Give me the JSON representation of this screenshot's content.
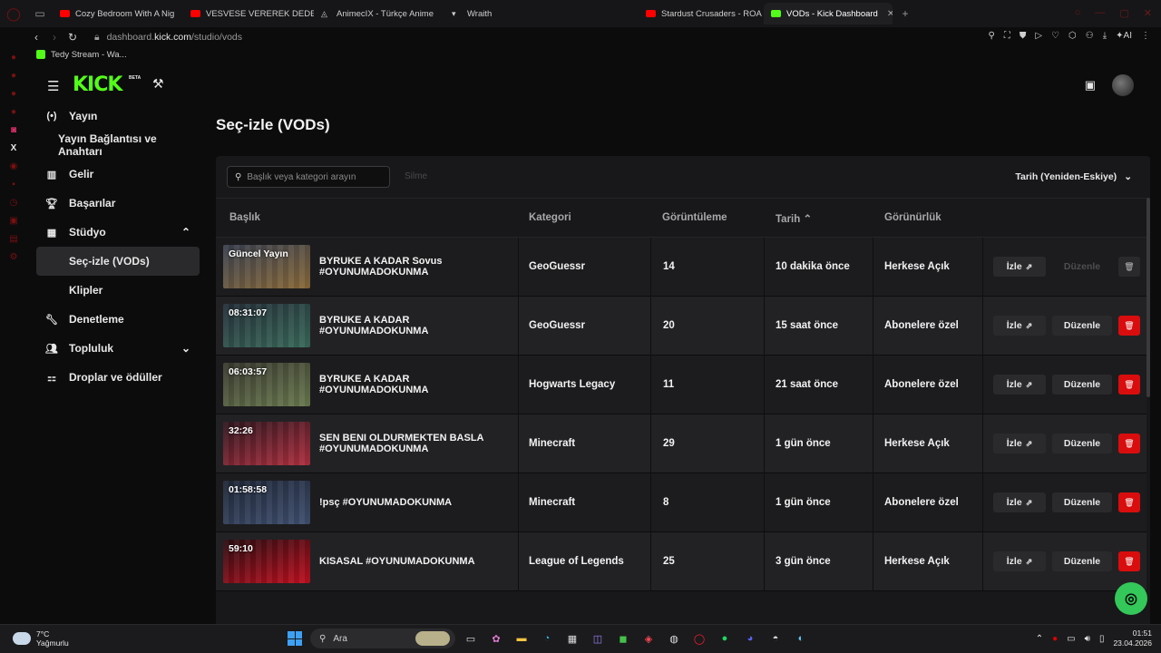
{
  "browser": {
    "tabs": [
      {
        "label": "Cozy Bedroom With A Nig",
        "favicon": "youtube-icon"
      },
      {
        "label": "VESVESE VEREREK DEDE",
        "favicon": "youtube-icon"
      },
      {
        "label": "AnimecIX - Türkçe Anime",
        "favicon": "animecix-icon"
      },
      {
        "label": "Wraith",
        "favicon": "wraith-icon"
      },
      {
        "label": "Stardust Crusaders - ROA",
        "favicon": "youtube-icon"
      },
      {
        "label": "VODs - Kick Dashboard",
        "favicon": "kick-icon",
        "active": true
      }
    ],
    "url_prefix": "dashboard.",
    "url_domain": "kick.com",
    "url_path": "/studio/vods",
    "ai_label": "AI",
    "bookmark": "Tedy Stream - Wa..."
  },
  "app": {
    "logo": "KICK",
    "beta": "BETA",
    "accent": "#53fc18"
  },
  "sidebar": {
    "items": [
      {
        "label": "Yayın",
        "icon": "broadcast-icon"
      },
      {
        "label": "Yayın Bağlantısı ve Anahtarı"
      },
      {
        "label": "Gelir",
        "icon": "revenue-icon"
      },
      {
        "label": "Başarılar",
        "icon": "trophy-icon"
      },
      {
        "label": "Stüdyo",
        "icon": "studio-icon"
      },
      {
        "label": "Seç-izle (VODs)"
      },
      {
        "label": "Klipler"
      },
      {
        "label": "Denetleme",
        "icon": "moderation-icon"
      },
      {
        "label": "Topluluk",
        "icon": "community-icon"
      },
      {
        "label": "Droplar ve ödüller",
        "icon": "drops-icon"
      }
    ]
  },
  "main": {
    "title": "Seç-izle (VODs)",
    "search_placeholder": "Başlık veya kategori arayın",
    "delete_label": "Silme",
    "sort_label": "Tarih (Yeniden-Eskiye)",
    "columns": [
      "Başlık",
      "Kategori",
      "Görüntüleme",
      "Tarih",
      "Görünürlük"
    ],
    "watch_label": "İzle",
    "edit_label": "Düzenle",
    "rows": [
      {
        "duration": "Güncel Yayın",
        "title": "BYRUKE A KADAR Sovus #OYUNUMADOKUNMA",
        "category": "GeoGuessr",
        "views": "14",
        "date": "10 dakika önce",
        "visibility": "Herkese Açık",
        "edit_disabled": true
      },
      {
        "duration": "08:31:07",
        "title": "BYRUKE A KADAR #OYUNUMADOKUNMA",
        "category": "GeoGuessr",
        "views": "20",
        "date": "15 saat önce",
        "visibility": "Abonelere özel"
      },
      {
        "duration": "06:03:57",
        "title": "BYRUKE A KADAR #OYUNUMADOKUNMA",
        "category": "Hogwarts Legacy",
        "views": "11",
        "date": "21 saat önce",
        "visibility": "Abonelere özel"
      },
      {
        "duration": "32:26",
        "title": "SEN BENI OLDURMEKTEN BASLA #OYUNUMADOKUNMA",
        "category": "Minecraft",
        "views": "29",
        "date": "1 gün önce",
        "visibility": "Herkese Açık"
      },
      {
        "duration": "01:58:58",
        "title": "!psç #OYUNUMADOKUNMA",
        "category": "Minecraft",
        "views": "8",
        "date": "1 gün önce",
        "visibility": "Abonelere özel"
      },
      {
        "duration": "59:10",
        "title": "KISASAL #OYUNUMADOKUNMA",
        "category": "League of Legends",
        "views": "25",
        "date": "3 gün önce",
        "visibility": "Herkese Açık"
      }
    ]
  },
  "taskbar": {
    "temperature": "7°C",
    "weather": "Yağmurlu",
    "search_label": "Ara",
    "time": "01:51",
    "date": "23.04.2026"
  }
}
